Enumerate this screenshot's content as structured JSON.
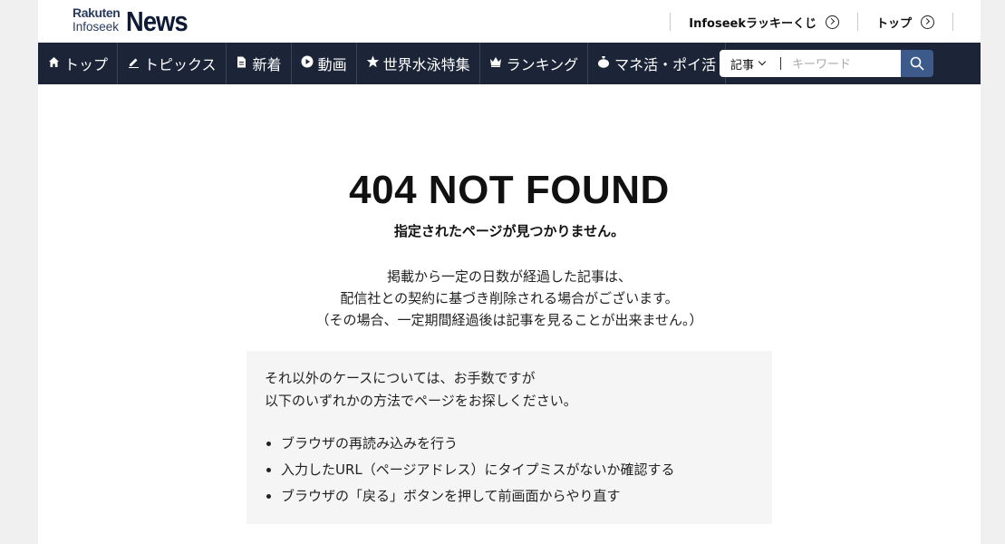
{
  "header": {
    "logo": {
      "rakuten": "Rakuten",
      "infoseek": "Infoseek",
      "news": "News"
    },
    "links": [
      {
        "label": "Infoseekラッキーくじ",
        "icon": "circle-chevron-right-icon"
      },
      {
        "label": "トップ",
        "icon": "circle-chevron-right-icon"
      }
    ]
  },
  "nav": {
    "items": [
      {
        "label": "トップ",
        "icon": "home-icon"
      },
      {
        "label": "トピックス",
        "icon": "pencil-icon"
      },
      {
        "label": "新着",
        "icon": "document-icon"
      },
      {
        "label": "動画",
        "icon": "play-icon"
      },
      {
        "label": "世界水泳特集",
        "icon": "star-icon"
      },
      {
        "label": "ランキング",
        "icon": "crown-icon"
      },
      {
        "label": "マネ活・ポイ活",
        "icon": "money-bag-icon"
      }
    ],
    "search": {
      "category": "記事",
      "placeholder": "キーワード",
      "button_icon": "search-icon",
      "button_color": "#3c5a8a"
    },
    "background": "#1b2537"
  },
  "main": {
    "title": "404 NOT FOUND",
    "subtitle": "指定されたページが見つかりません。",
    "description": [
      "掲載から一定の日数が経過した記事は、",
      "配信社との契約に基づき削除される場合がございます。",
      "（その場合、一定期間経過後は記事を見ることが出来ません。）"
    ],
    "box": {
      "lines": [
        "それ以外のケースについては、お手数ですが",
        "以下のいずれかの方法でページをお探しください。"
      ],
      "items": [
        "ブラウザの再読み込みを行う",
        "入力したURL（ページアドレス）にタイプミスがないか確認する",
        "ブラウザの「戻る」ボタンを押して前画面からやり直す"
      ]
    }
  }
}
